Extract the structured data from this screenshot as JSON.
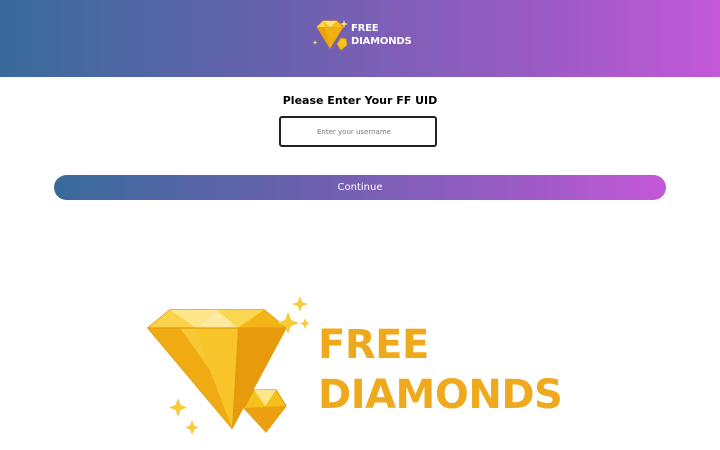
{
  "header": {
    "logo": {
      "icon": "diamond-icon",
      "line1": "FREE",
      "line2": "DIAMONDS"
    }
  },
  "form": {
    "title": "Please Enter Your FF UID",
    "uid_input": {
      "placeholder": "Enter your username",
      "value": ""
    },
    "continue_label": "Continue"
  },
  "banner": {
    "icon": "diamond-icon",
    "line1": "FREE",
    "line2": "DIAMONDS"
  },
  "colors": {
    "gradient_start": "#386b9a",
    "gradient_end": "#c458d8",
    "diamond_gold": "#f5c21b",
    "banner_text": "#eeaa1c"
  }
}
